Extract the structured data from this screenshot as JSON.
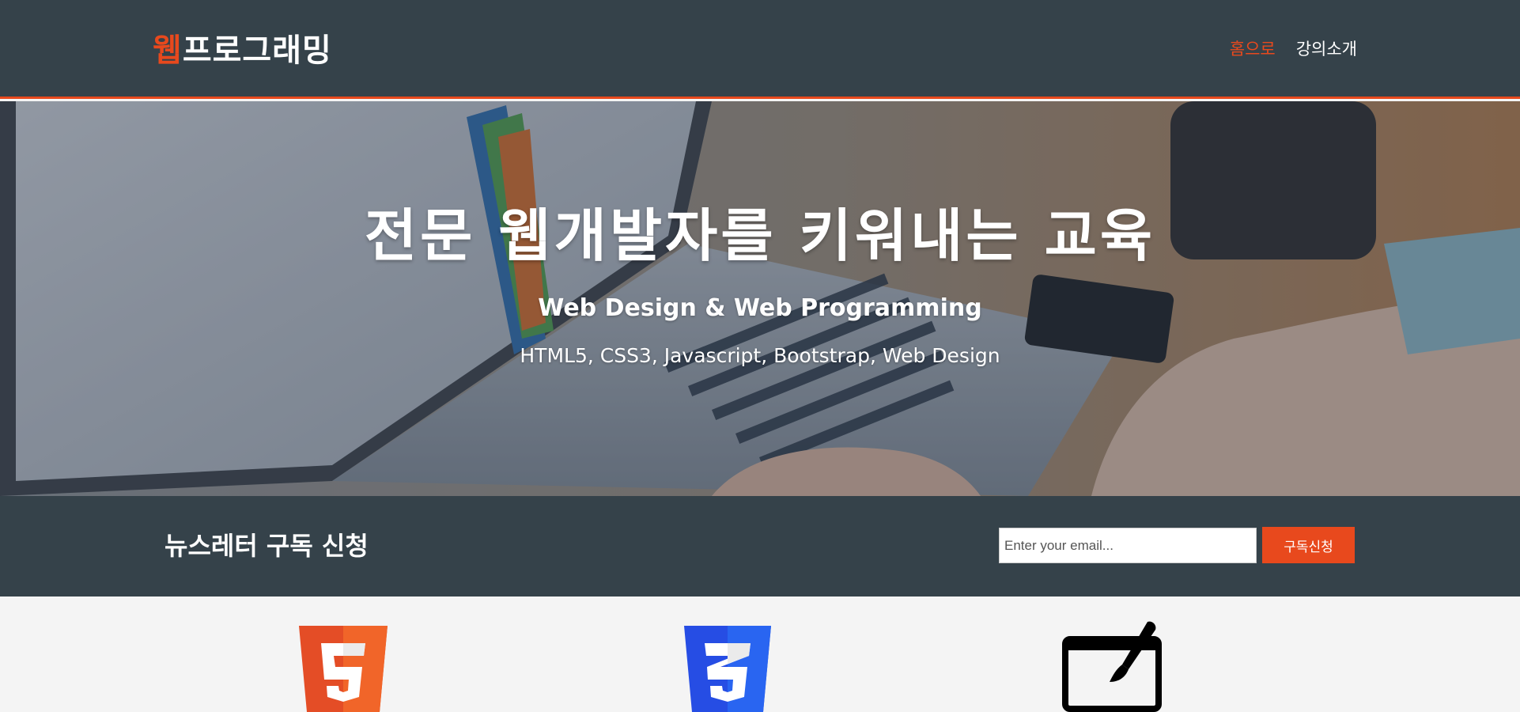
{
  "header": {
    "brand_accent": "웹",
    "brand_rest": "프로그래밍",
    "nav": [
      {
        "label": "홈으로",
        "active": true
      },
      {
        "label": "강의소개",
        "active": false
      }
    ]
  },
  "hero": {
    "title": "전문 웹개발자를 키워내는 교육",
    "subtitle": "Web Design & Web Programming",
    "tags": "HTML5, CSS3, Javascript, Bootstrap, Web Design"
  },
  "newsletter": {
    "title": "뉴스레터 구독 신청",
    "email_placeholder": "Enter your email...",
    "submit_label": "구독신청"
  },
  "features": [
    {
      "icon": "html5-logo-icon"
    },
    {
      "icon": "css3-logo-icon"
    },
    {
      "icon": "design-tablet-brush-icon"
    }
  ],
  "colors": {
    "accent": "#e8491d",
    "dark": "#35424a",
    "light_bg": "#f4f4f4"
  }
}
